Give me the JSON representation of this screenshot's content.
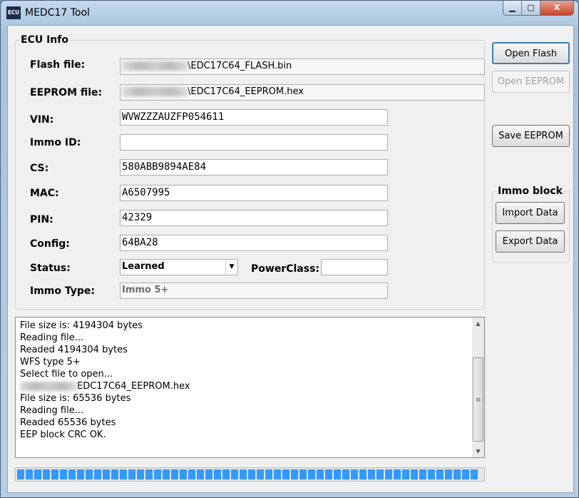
{
  "window": {
    "title": "MEDC17 Tool",
    "icon_text": "ECU"
  },
  "ecu_info": {
    "group_title": "ECU Info",
    "flash_file": {
      "label": "Flash file:",
      "value": "\\EDC17C64_FLASH.bin"
    },
    "eeprom_file": {
      "label": "EEPROM file:",
      "value": "\\EDC17C64_EEPROM.hex"
    },
    "vin": {
      "label": "VIN:",
      "value": "WVWZZZAUZFP054611"
    },
    "immo_id": {
      "label": "Immo ID:",
      "value": ""
    },
    "cs": {
      "label": "CS:",
      "value": "580ABB9894AE84"
    },
    "mac": {
      "label": "MAC:",
      "value": "A6507995"
    },
    "pin": {
      "label": "PIN:",
      "value": "42329"
    },
    "config": {
      "label": "Config:",
      "value": "64BA28"
    },
    "status": {
      "label": "Status:",
      "value": "Learned"
    },
    "power_class": {
      "label": "PowerClass:",
      "value": ""
    },
    "immo_type": {
      "label": "Immo Type:",
      "value": "Immo 5+"
    }
  },
  "buttons": {
    "open_flash": "Open Flash",
    "open_eeprom": "Open EEPROM",
    "save_eeprom": "Save EEPROM"
  },
  "immo_block": {
    "title": "Immo block",
    "import": "Import Data",
    "export": "Export Data"
  },
  "log": [
    "File size is: 4194304 bytes",
    "Reading file...",
    "Readed 4194304 bytes",
    "WFS type 5+",
    "Select file to open...",
    "EDC17C64_EEPROM.hex",
    "File size is: 65536 bytes",
    "Reading file...",
    "Readed 65536 bytes",
    "EEP block CRC OK."
  ],
  "progress_percent": 100
}
